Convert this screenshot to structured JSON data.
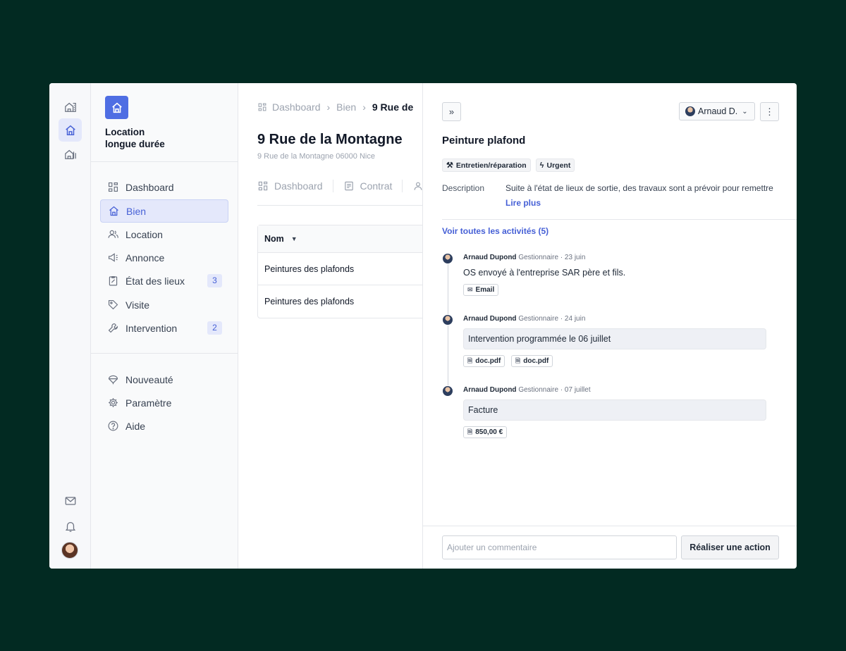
{
  "brand": {
    "name_line1": "Location",
    "name_line2": "longue durée"
  },
  "sidebar": {
    "items": [
      {
        "label": "Dashboard"
      },
      {
        "label": "Bien"
      },
      {
        "label": "Location"
      },
      {
        "label": "Annonce"
      },
      {
        "label": "État des lieux",
        "badge": "3"
      },
      {
        "label": "Visite"
      },
      {
        "label": "Intervention",
        "badge": "2"
      }
    ],
    "bottom_items": [
      {
        "label": "Nouveauté"
      },
      {
        "label": "Paramètre"
      },
      {
        "label": "Aide"
      }
    ]
  },
  "main": {
    "breadcrumb": [
      "Dashboard",
      "Bien",
      "9 Rue de"
    ],
    "title": "9 Rue de la Montagne",
    "subtitle": "9 Rue de la Montagne 06000 Nice",
    "tabs": [
      "Dashboard",
      "Contrat"
    ],
    "table": {
      "header": "Nom",
      "rows": [
        "Peintures des plafonds",
        "Peintures des plafonds"
      ]
    }
  },
  "panel": {
    "assignee": "Arnaud D.",
    "title": "Peinture plafond",
    "tags": [
      "Entretien/réparation",
      "Urgent"
    ],
    "description_label": "Description",
    "description": "Suite à l'état de lieux de sortie, des travaux sont a prévoir pour remettre",
    "read_more": "Lire plus",
    "all_activities": "Voir toutes les activités (5)",
    "activities": [
      {
        "author": "Arnaud Dupond",
        "role": "Gestionnaire",
        "date": "· 23 juin",
        "text": "OS envoyé à l'entreprise SAR père et fils.",
        "attachments": [
          "Email"
        ]
      },
      {
        "author": "Arnaud Dupond",
        "role": "Gestionnaire",
        "date": "· 24 juin",
        "text": "Intervention programmée le 06 juillet",
        "attachments": [
          "doc.pdf",
          "doc.pdf"
        ]
      },
      {
        "author": "Arnaud Dupond",
        "role": "Gestionnaire",
        "date": "· 07 juillet",
        "text": "Facture",
        "attachments": [
          "850,00 €"
        ]
      }
    ],
    "comment_placeholder": "Ajouter un commentaire",
    "action_label": "Réaliser une action"
  }
}
